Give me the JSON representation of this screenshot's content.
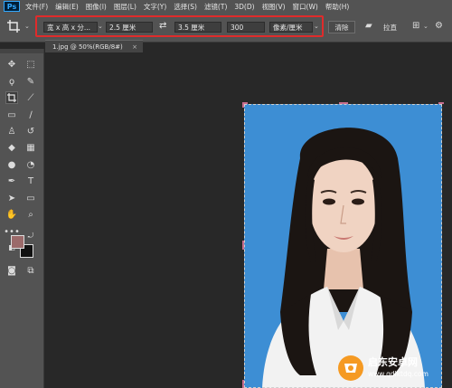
{
  "app": {
    "logo": "Ps"
  },
  "menu": [
    "文件(F)",
    "编辑(E)",
    "图像(I)",
    "图层(L)",
    "文字(Y)",
    "选择(S)",
    "滤镜(T)",
    "3D(D)",
    "视图(V)",
    "窗口(W)",
    "帮助(H)"
  ],
  "options": {
    "ratio_preset": "宽 x 高 x 分...",
    "width_value": "2.5 厘米",
    "height_value": "3.5 厘米",
    "resolution_value": "300",
    "resolution_unit": "像素/厘米",
    "clear_label": "清除",
    "straighten_label": "拉直",
    "highlight_color": "#e02b2b"
  },
  "document": {
    "tab_title": "1.jpg @ 50%(RGB/8#)",
    "close_glyph": "×"
  },
  "colors": {
    "foreground": "#9b6a6a",
    "background": "#111111",
    "photo_background": "#3d8ed4"
  },
  "watermark": {
    "name": "启东安卓网",
    "url": "www.qdlktdq.com"
  },
  "icons": [
    "crop-icon",
    "swap-icon",
    "straighten-icon",
    "grid-overlay-icon",
    "gear-icon",
    "move-icon",
    "marquee-icon",
    "lasso-icon",
    "quick-select-icon",
    "crop-icon",
    "eyedropper-icon",
    "healing-brush-icon",
    "brush-icon",
    "clone-stamp-icon",
    "history-brush-icon",
    "eraser-icon",
    "gradient-icon",
    "blur-icon",
    "dodge-icon",
    "pen-icon",
    "type-icon",
    "path-select-icon",
    "rectangle-icon",
    "hand-icon",
    "zoom-icon",
    "more-tools-icon",
    "quick-mask-icon",
    "screen-mode-icon"
  ]
}
